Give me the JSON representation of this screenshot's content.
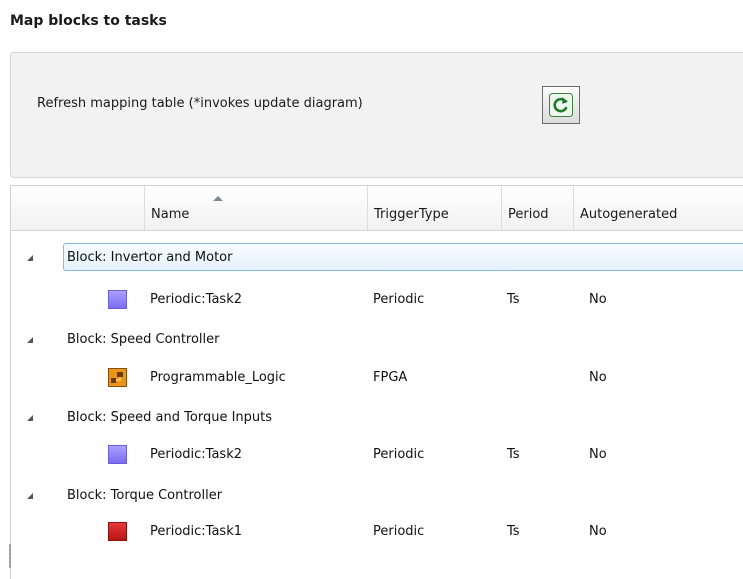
{
  "section": {
    "title": "Map blocks to tasks"
  },
  "refresh": {
    "label": "Refresh mapping table (*invokes update diagram)",
    "icon": "refresh-icon"
  },
  "table": {
    "columns": [
      {
        "label": "Name",
        "sorted": "ascending"
      },
      {
        "label": "TriggerType"
      },
      {
        "label": "Period"
      },
      {
        "label": "Autogenerated"
      }
    ],
    "groups": [
      {
        "label": "Block: Invertor and Motor",
        "selected": true,
        "task": {
          "name": "Periodic:Task2",
          "trigger": "Periodic",
          "period": "Ts",
          "autogenerated": "No",
          "icon": "purple-task-icon",
          "color": "#8c80f8"
        }
      },
      {
        "label": "Block: Speed Controller",
        "task": {
          "name": "Programmable_Logic",
          "trigger": "FPGA",
          "period": "",
          "autogenerated": "No",
          "icon": "fpga-logic-icon",
          "color": "#e8961a"
        }
      },
      {
        "label": "Block: Speed and Torque Inputs",
        "task": {
          "name": "Periodic:Task2",
          "trigger": "Periodic",
          "period": "Ts",
          "autogenerated": "No",
          "icon": "purple-task-icon",
          "color": "#8c80f8"
        }
      },
      {
        "label": "Block: Torque Controller",
        "task": {
          "name": "Periodic:Task1",
          "trigger": "Periodic",
          "period": "Ts",
          "autogenerated": "No",
          "icon": "red-task-icon",
          "color": "#cc2020"
        }
      }
    ]
  }
}
